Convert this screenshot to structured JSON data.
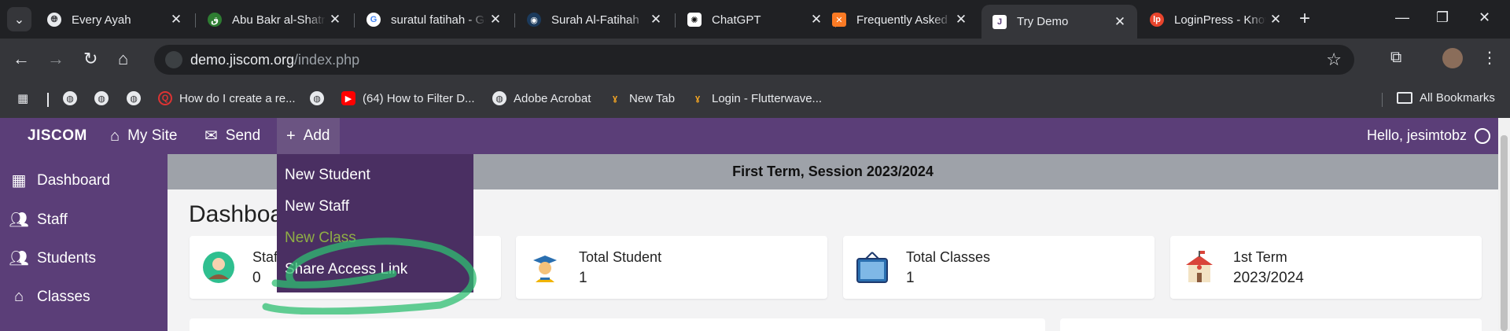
{
  "tabs": [
    {
      "title": "Every Ayah",
      "favicon": "globe-icon"
    },
    {
      "title": "Abu Bakr al-Shatri",
      "favicon": "quran-icon"
    },
    {
      "title": "suratul fatihah - Google",
      "favicon": "google-icon"
    },
    {
      "title": "Surah Al-Fatihah",
      "favicon": "quran-icon"
    },
    {
      "title": "ChatGPT",
      "favicon": "chatgpt-icon"
    },
    {
      "title": "Frequently Asked",
      "favicon": "xampp-icon"
    },
    {
      "title": "Try Demo",
      "favicon": "jiscom-icon",
      "active": true
    },
    {
      "title": "LoginPress - Knowledge",
      "favicon": "loginpress-icon"
    }
  ],
  "address": {
    "domain": "demo.jiscom.org",
    "path": "/index.php"
  },
  "bookmarks": [
    {
      "label": "How do I create a re...",
      "icon": "quora-icon"
    },
    {
      "label": "(64) How to Filter D...",
      "icon": "youtube-icon"
    },
    {
      "label": "Adobe Acrobat",
      "icon": "globe-icon"
    },
    {
      "label": "New Tab",
      "icon": "flutterwave-icon"
    },
    {
      "label": "Login - Flutterwave...",
      "icon": "flutterwave-icon"
    }
  ],
  "all_bookmarks": "All Bookmarks",
  "app": {
    "brand": "JISCOM",
    "nav": {
      "mysite": "My Site",
      "send": "Send",
      "add": "Add"
    },
    "greeting": "Hello, jesimtobz"
  },
  "sidebar": [
    {
      "label": "Dashboard",
      "icon": "dashboard-icon"
    },
    {
      "label": "Staff",
      "icon": "users-icon"
    },
    {
      "label": "Students",
      "icon": "users-icon"
    },
    {
      "label": "Classes",
      "icon": "home-icon"
    }
  ],
  "term_banner": "First Term, Session 2023/2024",
  "page_title": "Dashboard",
  "add_menu": [
    "New Student",
    "New Staff",
    "New Class",
    "Share Access Link"
  ],
  "cards": [
    {
      "label": "Staff",
      "value": "0",
      "icon": "staff-avatar-icon"
    },
    {
      "label": "Total Student",
      "value": "1",
      "icon": "graduate-icon"
    },
    {
      "label": "Total Classes",
      "value": "1",
      "icon": "classroom-sign-icon",
      "icon_text": "CLASS ROOM"
    },
    {
      "label": "1st Term",
      "value": "2023/2024",
      "icon": "school-building-icon"
    }
  ],
  "colors": {
    "nav_purple": "#5b3e78",
    "dropdown_purple": "#4a2f62",
    "highlight_green": "#2fbf71",
    "chrome_dark": "#202124"
  }
}
